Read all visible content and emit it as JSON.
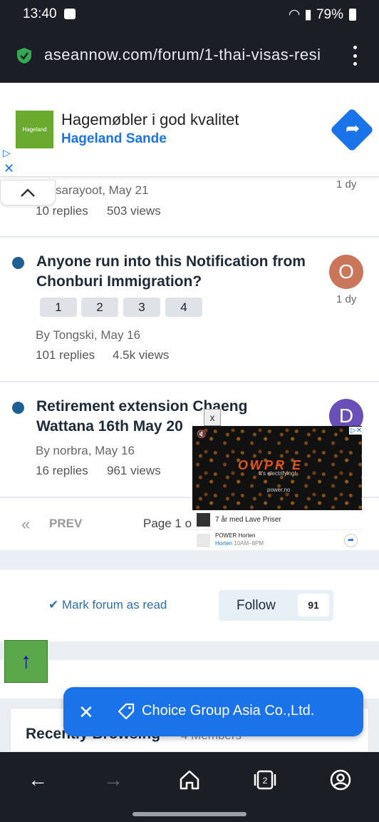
{
  "status_bar": {
    "time": "13:40",
    "battery": "79%"
  },
  "browser": {
    "url": "aseannow.com/forum/1-thai-visas-resi"
  },
  "ad_banner": {
    "logo_text": "Hageland",
    "title": "Hagemøbler i god kvalitet",
    "subtitle": "Hageland Sande"
  },
  "topics": [
    {
      "meta": "sarayoot, May 21",
      "replies": "10 replies",
      "views": "503 views",
      "ago": "1 dy"
    },
    {
      "title": "Anyone run into this Notification from Chonburi Immigration?",
      "pages": [
        "1",
        "2",
        "3",
        "4"
      ],
      "avatar_letter": "O",
      "avatar_color": "#c9765a",
      "ago": "1 dy",
      "meta": "By Tongski, May 16",
      "replies": "101 replies",
      "views": "4.5k views"
    },
    {
      "title": "Retirement extension Chaeng Wattana 16th May 20",
      "avatar_letter": "D",
      "avatar_color": "#6b4fb8",
      "meta": "By norbra, May 16",
      "replies": "16 replies",
      "views": "961 views"
    }
  ],
  "pagination": {
    "prev": "PREV",
    "page_info": "Page 1 o"
  },
  "video_ad": {
    "close": "x",
    "brand": "OWPR E",
    "tagline": "It's electrifying!",
    "site": "power.no",
    "promo": "7 år med Lave Priser",
    "store_name": "POWER Horten",
    "store_city": "Horten",
    "store_hours": "10AM–8PM"
  },
  "actions": {
    "mark_read": "Mark forum as read",
    "follow": "Follow",
    "follow_count": "91"
  },
  "recently": {
    "title": "Recently Browsing",
    "members": "4 Members"
  },
  "snackbar": {
    "text": "Choice Group Asia Co.,Ltd."
  },
  "back_to_top": "↑"
}
